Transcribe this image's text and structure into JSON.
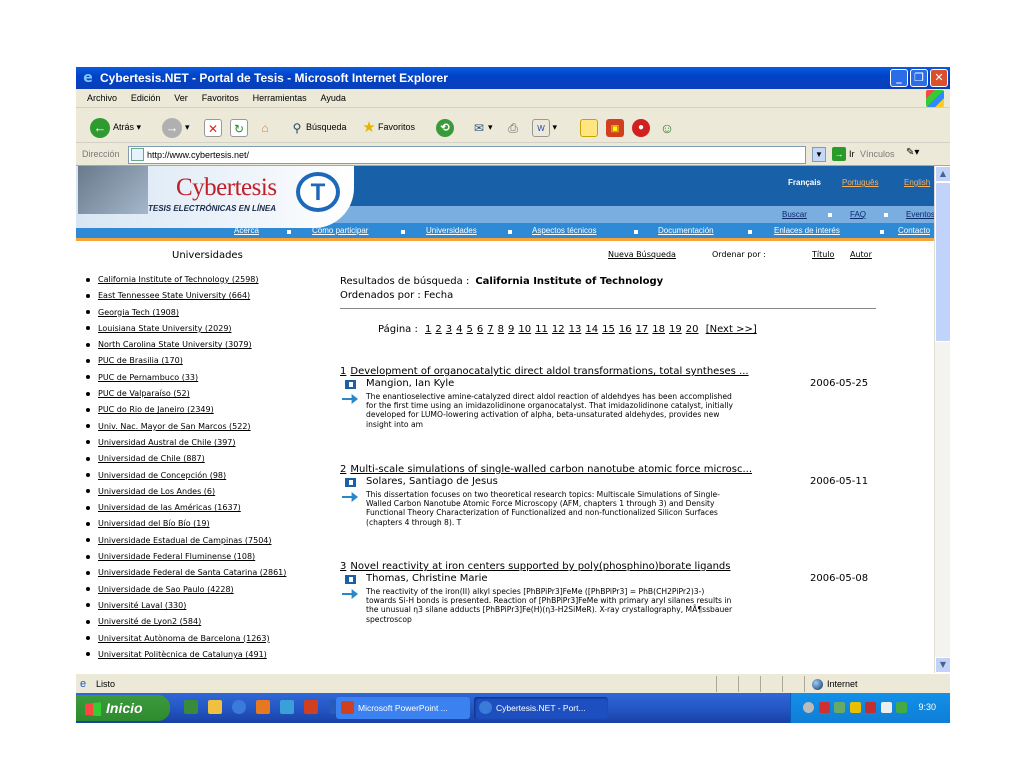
{
  "window": {
    "title": "Cybertesis.NET - Portal de Tesis - Microsoft Internet Explorer"
  },
  "menu": [
    "Archivo",
    "Edición",
    "Ver",
    "Favoritos",
    "Herramientas",
    "Ayuda"
  ],
  "toolbar": {
    "back": "Atrás",
    "search": "Búsqueda",
    "favorites": "Favoritos"
  },
  "address": {
    "label": "Dirección",
    "url": "http://www.cybertesis.net/",
    "go": "Ir",
    "links": "Vínculos"
  },
  "site": {
    "logo_text": "Cybertesis",
    "logo_subtitle": "TESIS ELECTRÓNICAS EN LÍNEA",
    "logo_letter": "T",
    "languages": [
      "Français",
      "Português",
      "English"
    ],
    "top_links": [
      "Buscar",
      "FAQ",
      "Eventos"
    ],
    "nav": [
      "Acerca",
      "Cómo participar",
      "Universidades",
      "Aspectos técnicos",
      "Documentación",
      "Enlaces de interés",
      "Contacto"
    ]
  },
  "sidebar": {
    "heading": "Universidades",
    "items": [
      "California Institute of Technology (2598)",
      "East Tennessee State University (664)",
      "Georgia Tech (1908)",
      "Louisiana State University (2029)",
      "North Carolina State University (3079)",
      "PUC de Brasilia (170)",
      "PUC de Pernambuco (33)",
      "PUC de Valparaíso (52)",
      "PUC do Rio de Janeiro (2349)",
      "Univ. Nac. Mayor de San Marcos (522)",
      "Universidad Austral de Chile (397)",
      "Universidad de Chile (887)",
      "Universidad de Concepción (98)",
      "Universidad de Los Andes (6)",
      "Universidad de las Américas (1637)",
      "Universidad del Bío Bío (19)",
      "Universidade Estadual de Campinas (7504)",
      "Universidade Federal Fluminense (108)",
      "Universidade Federal de Santa Catarina (2861)",
      "Universidade de Sao Paulo (4228)",
      "Université Laval (330)",
      "Université de Lyon2 (584)",
      "Universitat Autònoma de Barcelona (1263)",
      "Universitat Politècnica de Catalunya (491)"
    ]
  },
  "main": {
    "new_search": "Nueva Búsqueda",
    "order_by": "Ordenar por :",
    "sort_title": "Título",
    "sort_author": "Autor",
    "results_label": "Resultados de búsqueda :",
    "results_query": "California Institute of Technology",
    "ordered_label": "Ordenados por : Fecha",
    "page_label": "Página :",
    "pages": [
      "1",
      "2",
      "3",
      "4",
      "5",
      "6",
      "7",
      "8",
      "9",
      "10",
      "11",
      "12",
      "13",
      "14",
      "15",
      "16",
      "17",
      "18",
      "19",
      "20"
    ],
    "next": "[Next >>]",
    "results": [
      {
        "num": "1",
        "title": "Development of organocatalytic direct aldol transformations, total syntheses ...",
        "author": "Mangion, Ian Kyle",
        "date": "2006-05-25",
        "abstract": "The enantioselective amine-catalyzed direct aldol reaction of aldehdyes has been accomplished for the first time using an imidazolidinone organocatalyst. That imidazolidinone catalyst, initially developed for LUMO-lowering activation of alpha, beta-unsaturated aldehydes, provides new insight into am"
      },
      {
        "num": "2",
        "title": "Multi-scale simulations of single-walled carbon nanotube atomic force microsc...",
        "author": "Solares, Santiago de Jesus",
        "date": "2006-05-11",
        "abstract": "This dissertation focuses on two theoretical research topics: Multiscale Simulations of Single-Walled Carbon Nanotube Atomic Force Microscopy (AFM, chapters 1 through 3) and Density Functional Theory Characterization of Functionalized and non-functionalized Silicon Surfaces (chapters 4 through 8). T"
      },
      {
        "num": "3",
        "title": "Novel reactivity at iron centers supported by poly(phosphino)borate ligands",
        "author": "Thomas, Christine Marie",
        "date": "2006-05-08",
        "abstract": "The reactivity of the iron(II) alkyl species [PhBPiPr3]FeMe ([PhBPiPr3] = PhB(CH2PiPr2)3-) towards Si-H bonds is presented. Reaction of [PhBPiPr3]FeMe with primary aryl silanes results in the unusual η3 silane adducts [PhBPiPr3]Fe(H)(η3-H2SiMeR). X-ray crystallography, MÃ¶ssbauer spectroscop"
      }
    ]
  },
  "status": {
    "text": "Listo",
    "zone": "Internet"
  },
  "taskbar": {
    "start": "Inicio",
    "tasks": [
      "Microsoft PowerPoint ...",
      "Cybertesis.NET - Port..."
    ],
    "clock": "9:30"
  }
}
